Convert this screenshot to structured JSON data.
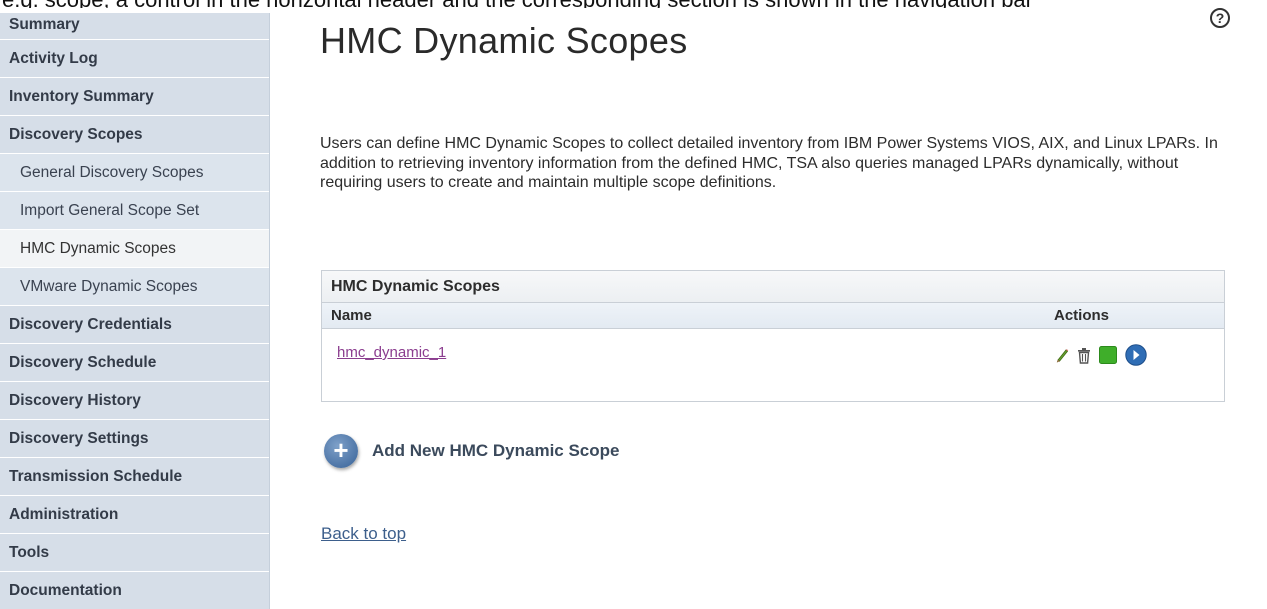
{
  "top_strip": {
    "text": "e.g. scope, a control in the horizontal header and the corresponding section is shown in the navigation bar"
  },
  "sidebar": {
    "items": [
      {
        "label": "Summary"
      },
      {
        "label": "Activity Log"
      },
      {
        "label": "Inventory Summary"
      },
      {
        "label": "Discovery Scopes"
      },
      {
        "label": "General Discovery Scopes"
      },
      {
        "label": "Import General Scope Set"
      },
      {
        "label": "HMC Dynamic Scopes"
      },
      {
        "label": "VMware Dynamic Scopes"
      },
      {
        "label": "Discovery Credentials"
      },
      {
        "label": "Discovery Schedule"
      },
      {
        "label": "Discovery History"
      },
      {
        "label": "Discovery Settings"
      },
      {
        "label": "Transmission Schedule"
      },
      {
        "label": "Administration"
      },
      {
        "label": "Tools"
      },
      {
        "label": "Documentation"
      }
    ]
  },
  "header": {
    "title": "HMC Dynamic Scopes",
    "help_glyph": "?"
  },
  "main": {
    "description": "Users can define HMC Dynamic Scopes to collect detailed inventory from IBM Power Systems VIOS, AIX, and Linux LPARs. In addition to retrieving inventory information from the defined HMC, TSA also queries managed LPARs dynamically, without requiring users to create and maintain multiple scope definitions.",
    "table": {
      "caption": "HMC Dynamic Scopes",
      "columns": {
        "name": "Name",
        "actions": "Actions"
      },
      "rows": [
        {
          "name": "hmc_dynamic_1"
        }
      ],
      "action_icons": [
        "edit-icon",
        "delete-icon",
        "status-icon",
        "run-icon"
      ]
    },
    "add_new_label": "Add New HMC Dynamic Scope",
    "add_glyph": "+",
    "back_to_top": "Back to top"
  },
  "colors": {
    "sidebar_bg": "#d6dee8",
    "sidebar_active_bg": "#f2f4f6",
    "link_visited": "#8b3d8f",
    "link": "#3d5f8c",
    "status_green": "#3fae2a",
    "run_blue": "#2f6db5"
  }
}
